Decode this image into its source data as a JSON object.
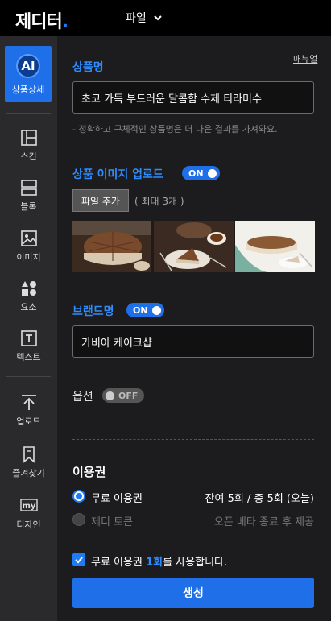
{
  "header": {
    "logo_text": "제디터",
    "logo_dot": ".",
    "file_menu_label": "파일"
  },
  "sidebar": {
    "ai_badge": "AI",
    "ai_label": "상품상세",
    "items": [
      {
        "label": "스킨",
        "icon": "skin-icon"
      },
      {
        "label": "블록",
        "icon": "block-icon"
      },
      {
        "label": "이미지",
        "icon": "image-icon"
      },
      {
        "label": "요소",
        "icon": "element-icon"
      },
      {
        "label": "텍스트",
        "icon": "text-icon"
      },
      {
        "label": "업로드",
        "icon": "upload-icon"
      },
      {
        "label": "즐겨찾기",
        "icon": "bookmark-icon"
      },
      {
        "label": "디자인",
        "icon": "my-design-icon"
      }
    ]
  },
  "main": {
    "manual_link": "매뉴얼",
    "product_name": {
      "title": "상품명",
      "value": "초코 가득 부드러운 달콤함 수제 티라미수",
      "hint": "- 정확하고 구체적인 상품명은 더 나은 결과를 가져와요."
    },
    "product_image": {
      "title": "상품 이미지 업로드",
      "toggle": "ON",
      "add_button": "파일 추가",
      "max_note": "( 최대 3개 )"
    },
    "brand": {
      "title": "브랜드명",
      "toggle": "ON",
      "value": "가비아 케이크샵"
    },
    "options": {
      "title": "옵션",
      "toggle": "OFF"
    },
    "usage": {
      "title": "이용권",
      "free_pass_label": "무료 이용권",
      "free_pass_status": "잔여 5회 / 총 5회 (오늘)",
      "token_label": "제디 토큰",
      "token_status": "오픈 베타 종료 후 제공"
    },
    "confirm": {
      "prefix": "무료 이용권 ",
      "count": "1회",
      "suffix": "를 사용합니다."
    },
    "generate_button": "생성"
  },
  "colors": {
    "accent": "#1f6fe8",
    "sidebar_bg": "#2a2a2c",
    "panel_bg": "#1c1c1e"
  }
}
